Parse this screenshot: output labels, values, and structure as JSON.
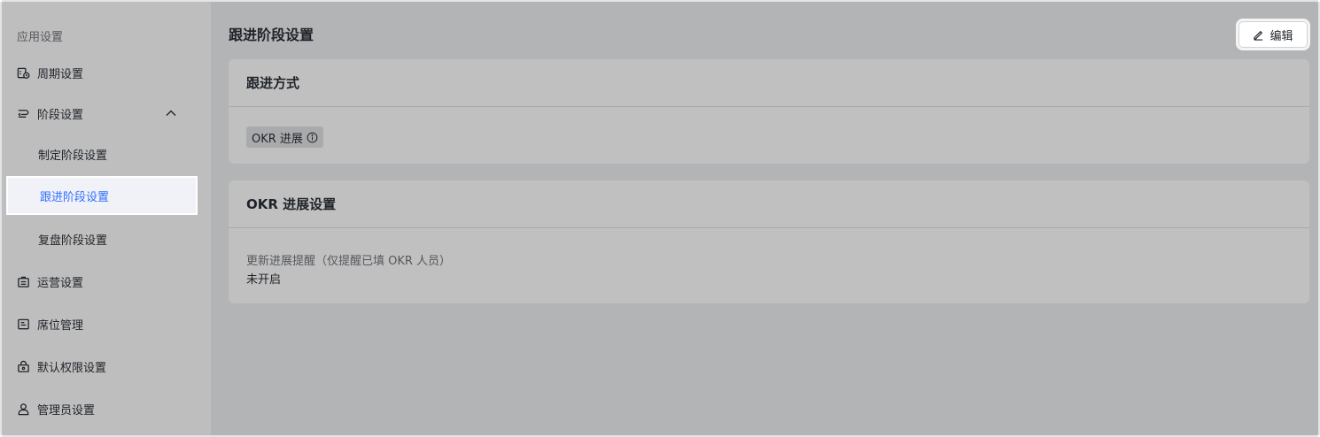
{
  "sidebar": {
    "heading": "应用设置",
    "items": [
      {
        "label": "周期设置",
        "icon": "calendar-icon"
      },
      {
        "label": "阶段设置",
        "icon": "stage-icon",
        "expanded": true
      },
      {
        "label": "运营设置",
        "icon": "operation-icon"
      },
      {
        "label": "席位管理",
        "icon": "seat-icon"
      },
      {
        "label": "默认权限设置",
        "icon": "lock-icon"
      },
      {
        "label": "管理员设置",
        "icon": "user-icon"
      }
    ],
    "sub_items": [
      {
        "label": "制定阶段设置"
      },
      {
        "label": "跟进阶段设置",
        "active": true
      },
      {
        "label": "复盘阶段设置"
      }
    ]
  },
  "main": {
    "title": "跟进阶段设置",
    "edit_label": "编辑",
    "cards": {
      "method": {
        "title": "跟进方式",
        "tag": "OKR 进展"
      },
      "progress": {
        "title": "OKR 进展设置",
        "field_label": "更新进展提醒（仅提醒已填 OKR 人员）",
        "field_value": "未开启"
      }
    }
  },
  "colors": {
    "accent": "#3370ff",
    "sidebar_bg": "#bebebe",
    "main_bg": "#b3b4b6",
    "card_bg": "#c0c0c0"
  }
}
